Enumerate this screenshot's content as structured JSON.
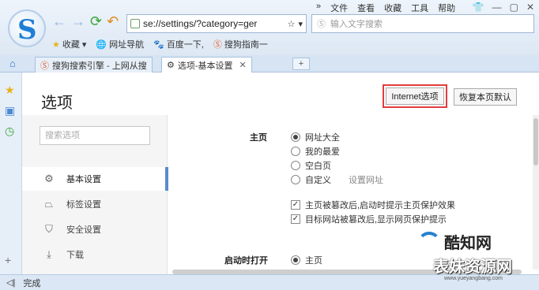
{
  "menu": [
    "文件",
    "查看",
    "收藏",
    "工具",
    "帮助"
  ],
  "nav": {
    "address": "se://settings/?category=ger",
    "search_placeholder": "输入文字搜索"
  },
  "bookmarks": [
    "收藏",
    "网址导航",
    "百度一下,",
    "搜狗指南一"
  ],
  "tabs": [
    {
      "label": "搜狗搜索引擎 - 上网从搜",
      "active": false
    },
    {
      "label": "选项-基本设置",
      "active": true
    }
  ],
  "page": {
    "title": "选项",
    "internet_options": "Internet选项",
    "reset_default": "恢复本页默认",
    "search_placeholder": "搜索选项"
  },
  "categories": [
    {
      "label": "基本设置",
      "icon": "gear-icon",
      "active": true
    },
    {
      "label": "标签设置",
      "icon": "tab-icon",
      "active": false
    },
    {
      "label": "安全设置",
      "icon": "shield-icon",
      "active": false
    },
    {
      "label": "下载",
      "icon": "download-icon",
      "active": false
    }
  ],
  "homepage": {
    "label": "主页",
    "options": [
      {
        "label": "网址大全",
        "selected": true
      },
      {
        "label": "我的最爱",
        "selected": false
      },
      {
        "label": "空白页",
        "selected": false
      },
      {
        "label": "自定义",
        "selected": false
      }
    ],
    "set_url": "设置网址",
    "checks": [
      {
        "label": "主页被篡改后,启动时提示主页保护效果",
        "checked": true
      },
      {
        "label": "目标网站被篡改后,显示网页保护提示",
        "checked": true
      }
    ]
  },
  "startup": {
    "label": "启动时打开",
    "options": [
      {
        "label": "主页",
        "selected": true
      }
    ]
  },
  "status": {
    "text": "完成"
  },
  "watermark": {
    "line1": "酷知网",
    "line2": "表妹资源网",
    "line3": "www.yueyangbang.com"
  }
}
